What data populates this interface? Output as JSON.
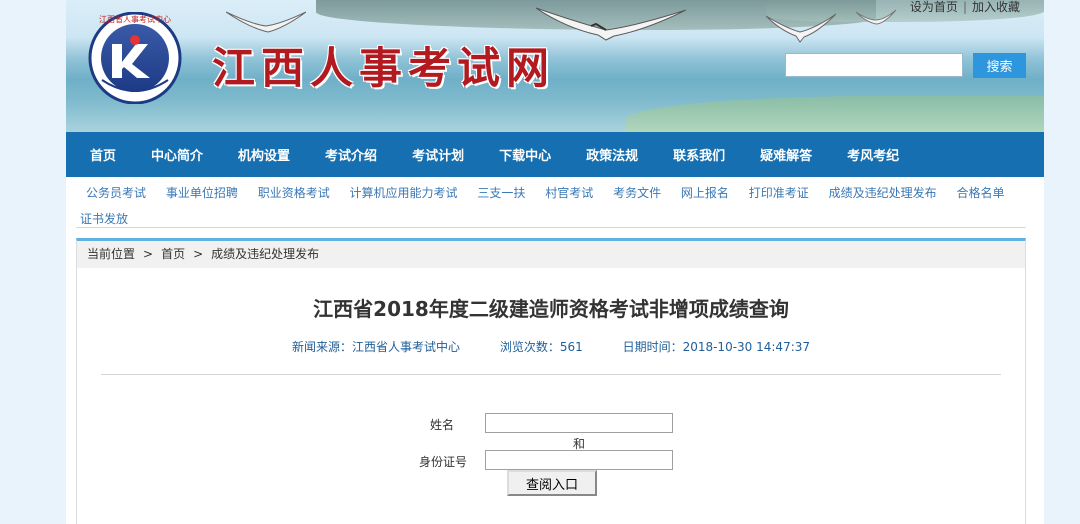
{
  "header": {
    "site_title": "江西人事考试网",
    "logo_text": "江西省人事考试中心",
    "toplinks": {
      "set_home": "设为首页",
      "separator": "|",
      "add_favorite": "加入收藏"
    },
    "search": {
      "button_label": "搜索",
      "value": "",
      "placeholder": ""
    }
  },
  "nav": {
    "items": [
      {
        "label": "首页"
      },
      {
        "label": "中心简介"
      },
      {
        "label": "机构设置"
      },
      {
        "label": "考试介绍"
      },
      {
        "label": "考试计划"
      },
      {
        "label": "下载中心"
      },
      {
        "label": "政策法规"
      },
      {
        "label": "联系我们"
      },
      {
        "label": "疑难解答"
      },
      {
        "label": "考风考纪"
      }
    ]
  },
  "subnav": {
    "items": [
      {
        "label": "公务员考试"
      },
      {
        "label": "事业单位招聘"
      },
      {
        "label": "职业资格考试"
      },
      {
        "label": "计算机应用能力考试"
      },
      {
        "label": "三支一扶"
      },
      {
        "label": "村官考试"
      },
      {
        "label": "考务文件"
      },
      {
        "label": "网上报名"
      },
      {
        "label": "打印准考证"
      },
      {
        "label": "成绩及违纪处理发布"
      },
      {
        "label": "合格名单"
      },
      {
        "label": "证书发放"
      }
    ]
  },
  "breadcrumb": {
    "prefix": "当前位置",
    "sep": ">",
    "items": [
      "首页",
      "成绩及违纪处理发布"
    ]
  },
  "article": {
    "title": "江西省2018年度二级建造师资格考试非增项成绩查询",
    "source": "新闻来源：江西省人事考试中心",
    "views": "浏览次数：561",
    "date": "日期时间：2018-10-30 14:47:37"
  },
  "form": {
    "name_label": "姓名",
    "name_value": "",
    "and_text": "和",
    "id_label": "身份证号",
    "id_value": "",
    "submit_label": "查阅入口"
  },
  "colors": {
    "nav_bg": "#166fb0",
    "title_red": "#b21a20",
    "search_btn": "#2d96dc",
    "link_blue": "#3a78b5",
    "panel_top": "#61b2e3"
  }
}
